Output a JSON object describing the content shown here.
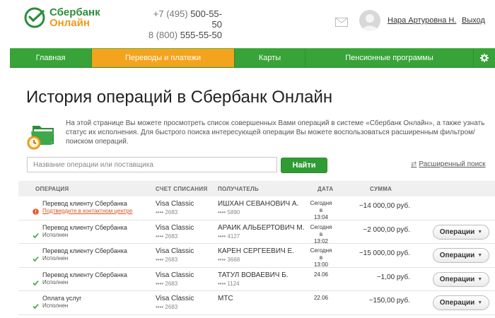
{
  "header": {
    "logo_line1": "Сбербанк",
    "logo_line2": "Онлайн",
    "phone1_code": "+7 (495)",
    "phone1_number": "500-55-50",
    "phone2_code": "8 (800)",
    "phone2_number": "555-55-50",
    "user_name": "Нара Артуровна Н.",
    "logout_label": "Выход"
  },
  "nav": {
    "items": [
      {
        "label": "Главная",
        "active": false
      },
      {
        "label": "Переводы и платежи",
        "active": true
      },
      {
        "label": "Карты",
        "active": false
      },
      {
        "label": "Пенсионные программы",
        "active": false
      }
    ]
  },
  "page": {
    "title": "История операций в Сбербанк Онлайн",
    "intro": "На этой странице Вы можете просмотреть список совершенных Вами операций в системе «Сбербанк Онлайн», а также узнать статус их исполнения. Для быстрого поиска интересующей операции Вы можете воспользоваться расширенным фильтром/поиском операций."
  },
  "search": {
    "placeholder": "Название операции или поставщика",
    "button_label": "Найти",
    "advanced_label": "Расширенный поиск"
  },
  "table": {
    "headers": {
      "operation": "ОПЕРАЦИЯ",
      "account": "СЧЕТ СПИСАНИЯ",
      "recipient": "ПОЛУЧАТЕЛЬ",
      "date": "ДАТА",
      "amount": "СУММА"
    },
    "rows": [
      {
        "name": "Перевод клиенту Сбербанка",
        "status": "Подтвердите в контактном центре",
        "status_type": "warn",
        "account": "Visa Classic",
        "account_num": "•••• 2683",
        "recipient": "ИШХАН СЕВАНОВИЧ А.",
        "recipient_num": "•••• 5890",
        "date_line1": "Сегодня в",
        "date_line2": "13:04",
        "amount": "−14 000,00 руб.",
        "has_button": false
      },
      {
        "name": "Перевод клиенту Сбербанка",
        "status": "Исполнен",
        "status_type": "ok",
        "account": "Visa Classic",
        "account_num": "•••• 2683",
        "recipient": "АРАИК АЛЬБЕРТОВИЧ М.",
        "recipient_num": "•••• 4127",
        "date_line1": "Сегодня в",
        "date_line2": "13:02",
        "amount": "−2 000,00 руб.",
        "has_button": true
      },
      {
        "name": "Перевод клиенту Сбербанка",
        "status": "Исполнен",
        "status_type": "ok",
        "account": "Visa Classic",
        "account_num": "•••• 2683",
        "recipient": "КАРЕН СЕРГЕЕВИЧ Е.",
        "recipient_num": "•••• 3668",
        "date_line1": "Сегодня в",
        "date_line2": "13:00",
        "amount": "−15 000,00 руб.",
        "has_button": true
      },
      {
        "name": "Перевод клиенту Сбербанка",
        "status": "Исполнен",
        "status_type": "ok",
        "account": "Visa Classic",
        "account_num": "•••• 2683",
        "recipient": "ТАТУЛ ВОВАЕВИЧ Б.",
        "recipient_num": "•••• 1124",
        "date_line1": "24.06",
        "date_line2": "",
        "amount": "−1,00 руб.",
        "has_button": true
      },
      {
        "name": "Оплата услуг",
        "status": "Исполнен",
        "status_type": "ok",
        "account": "Visa Classic",
        "account_num": "•••• 2683",
        "recipient": "МТС",
        "recipient_num": "",
        "date_line1": "22.06",
        "date_line2": "",
        "amount": "−150,00 руб.",
        "has_button": true
      }
    ],
    "ops_button_label": "Операции"
  },
  "colors": {
    "brand_green": "#37a338",
    "active_orange": "#f4a31d",
    "warn": "#d9531e"
  }
}
